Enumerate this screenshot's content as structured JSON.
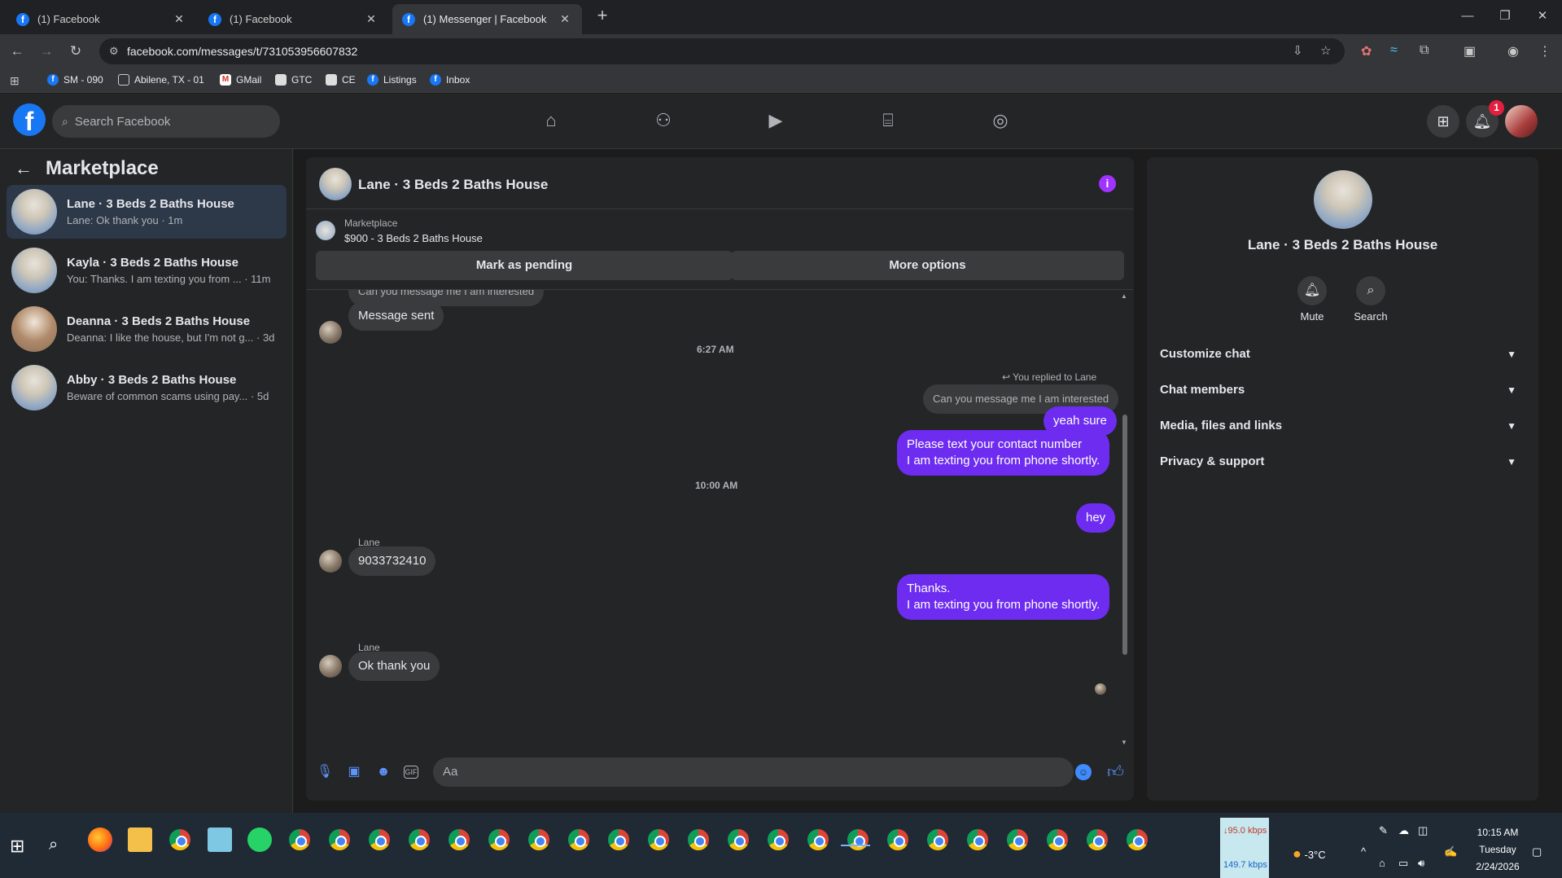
{
  "browser": {
    "tabs": [
      {
        "title": "(1) Facebook"
      },
      {
        "title": "(1) Facebook"
      },
      {
        "title": "(1) Messenger | Facebook"
      }
    ],
    "url": "facebook.com/messages/t/731053956607832",
    "bookmarks": [
      "SM - 090",
      "Abilene, TX - 01",
      "GMail",
      "GTC",
      "CE",
      "Listings",
      "Inbox"
    ]
  },
  "fb": {
    "search_placeholder": "Search Facebook",
    "notification_count": "1"
  },
  "left": {
    "title": "Marketplace",
    "conversations": [
      {
        "name": "Lane · 3 Beds 2 Baths House",
        "preview": "Lane: Ok thank you · 1m"
      },
      {
        "name": "Kayla · 3 Beds 2 Baths House",
        "preview": "You: Thanks. I am texting you from ... · 11m"
      },
      {
        "name": "Deanna · 3 Beds 2 Baths House",
        "preview": "Deanna: I like the house, but I'm not g... · 3d"
      },
      {
        "name": "Abby · 3 Beds 2 Baths House",
        "preview": "Beware of common scams using pay... · 5d"
      }
    ]
  },
  "chat": {
    "title": "Lane · 3 Beds 2 Baths House",
    "marketplace_label": "Marketplace",
    "listing": "$900 - 3 Beds 2 Baths House",
    "mark_pending": "Mark as pending",
    "more_options": "More options",
    "messages": {
      "cut_quote": "Can you message me I am interested",
      "m1": "Message sent",
      "time1": "6:27 AM",
      "replied": "You replied to Lane",
      "quote": "Can you message me I am interested",
      "m2": "yeah sure",
      "m3a": "Please text your contact number",
      "m3b": "I am texting you from phone shortly.",
      "time2": "10:00 AM",
      "m4": "hey",
      "sender1": "Lane",
      "m5": "9033732410",
      "m6a": "Thanks.",
      "m6b": "I am texting you from phone shortly.",
      "sender2": "Lane",
      "m7": "Ok thank you"
    },
    "composer_placeholder": "Aa"
  },
  "right": {
    "title": "Lane · 3 Beds 2 Baths House",
    "mute": "Mute",
    "search": "Search",
    "sections": [
      "Customize chat",
      "Chat members",
      "Media, files and links",
      "Privacy & support"
    ]
  },
  "taskbar": {
    "net_down": "95.0 kbps",
    "net_up": "149.7 kbps",
    "weather": "-3°C",
    "time": "10:15 AM",
    "day": "Tuesday",
    "date": "2/24/2026"
  }
}
